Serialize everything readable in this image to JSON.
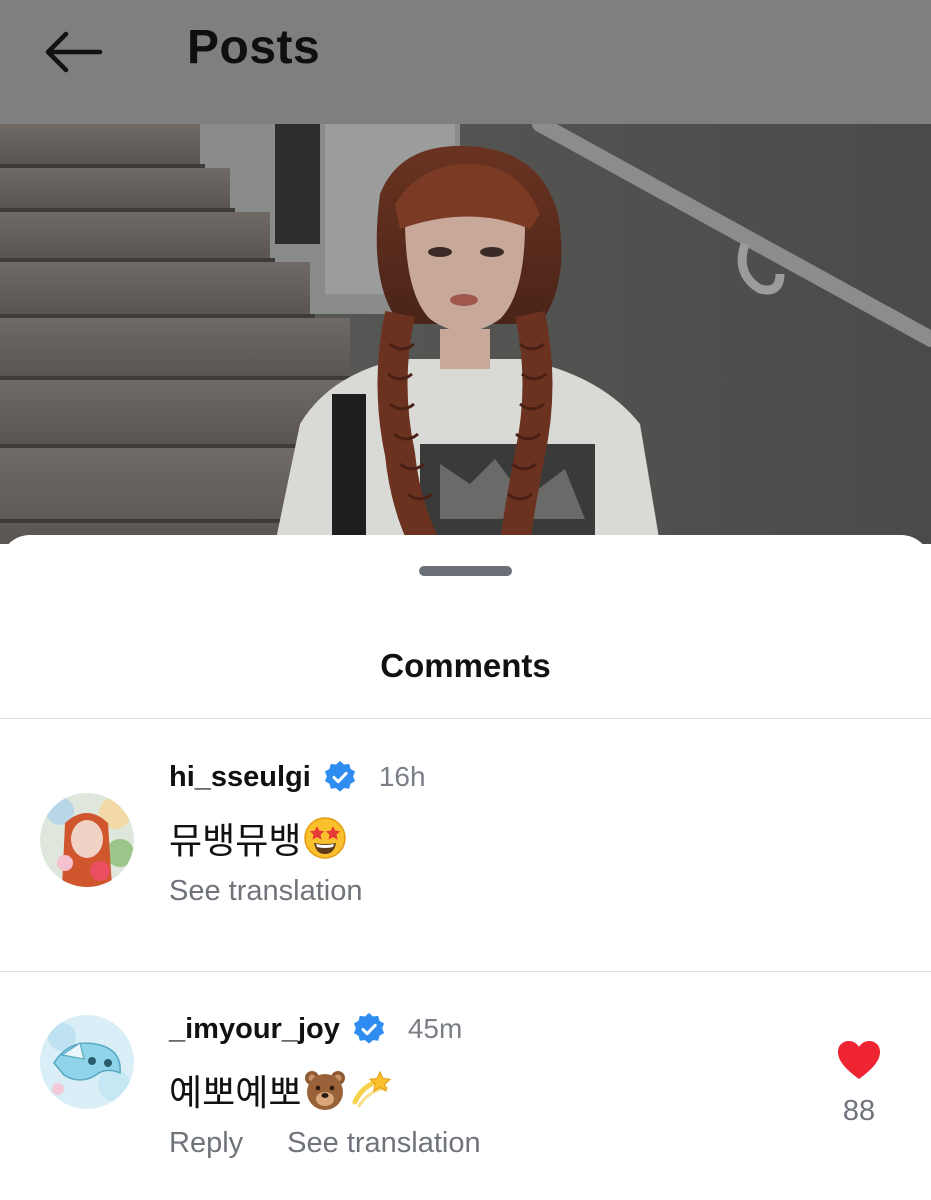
{
  "header": {
    "title": "Posts",
    "back_icon": "arrow-left-icon"
  },
  "photo": {
    "content": "photo"
  },
  "sheet": {
    "title": "Comments"
  },
  "comments": [
    {
      "username": "hi_sseulgi",
      "verified": true,
      "time": "16h",
      "text": "뮤뱅뮤뱅",
      "emojis": [
        "star-struck-emoji"
      ],
      "actions": [
        "See translation"
      ]
    },
    {
      "username": "_imyour_joy",
      "verified": true,
      "time": "45m",
      "text": "예뽀예뽀",
      "emojis": [
        "bear-face-emoji",
        "dizzy-star-emoji"
      ],
      "actions": [
        "Reply",
        "See translation"
      ],
      "likes": "88",
      "liked": true
    }
  ],
  "colors": {
    "header_bg": "#7f7f7f",
    "verified_blue": "#2f8cf0",
    "like_red": "#ee2433",
    "secondary_text": "#6f737a"
  }
}
